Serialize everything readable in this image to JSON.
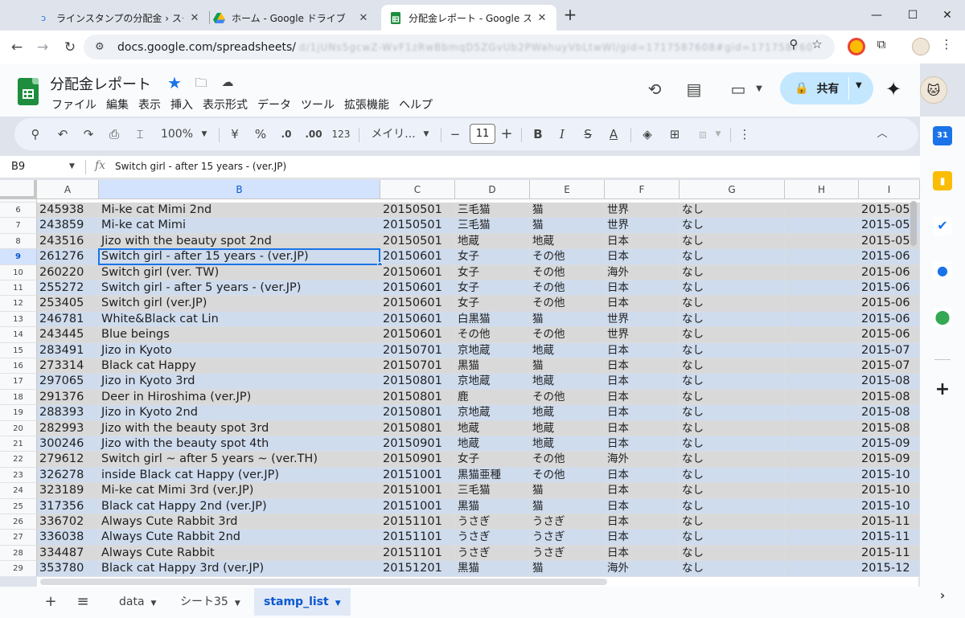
{
  "browser": {
    "tabs": [
      {
        "title": "ラインスタンプの分配金 › スタンプ制",
        "favicon": "spinner-icon",
        "active": false
      },
      {
        "title": "ホーム - Google ドライブ",
        "favicon": "drive-icon",
        "active": false
      },
      {
        "title": "分配金レポート - Google スプレッ",
        "favicon": "sheets-icon",
        "active": true
      }
    ],
    "url": "docs.google.com/spreadsheets/",
    "url_blurred": "d/1jUNs5gcwZ-WvF1zRwBbmqD5ZGvUb2PWahuyVbLtwWl/gid=1717587608#gid=1717587608&fvid=78511"
  },
  "document": {
    "title": "分配金レポート",
    "menu": [
      "ファイル",
      "編集",
      "表示",
      "挿入",
      "表示形式",
      "データ",
      "ツール",
      "拡張機能",
      "ヘルプ"
    ],
    "share_label": "共有"
  },
  "toolbar": {
    "zoom": "100%",
    "currency": "¥",
    "percent": "%",
    "dec_decrease": ".0",
    "dec_increase": ".00",
    "number_format": "123",
    "font": "メイリ...",
    "font_size": "11"
  },
  "formula_bar": {
    "cell_ref": "B9",
    "formula": "Switch girl - after 15 years - (ver.JP)"
  },
  "grid": {
    "columns": [
      "A",
      "B",
      "C",
      "D",
      "E",
      "F",
      "G",
      "H",
      "I"
    ],
    "selected_column": "B",
    "selected_row": "9",
    "rows": [
      {
        "n": "6",
        "a": "245938",
        "b": "Mi-ke cat Mimi 2nd",
        "c": "20150501",
        "d": "三毛猫",
        "e": "猫",
        "f": "世界",
        "g": "なし",
        "h": "",
        "i": "2015-05"
      },
      {
        "n": "7",
        "a": "243859",
        "b": "Mi-ke cat Mimi",
        "c": "20150501",
        "d": "三毛猫",
        "e": "猫",
        "f": "世界",
        "g": "なし",
        "h": "",
        "i": "2015-05"
      },
      {
        "n": "8",
        "a": "243516",
        "b": "Jizo with the beauty spot 2nd",
        "c": "20150501",
        "d": "地蔵",
        "e": "地蔵",
        "f": "日本",
        "g": "なし",
        "h": "",
        "i": "2015-05"
      },
      {
        "n": "9",
        "a": "261276",
        "b": "Switch girl - after 15 years - (ver.JP)",
        "c": "20150601",
        "d": "女子",
        "e": "その他",
        "f": "日本",
        "g": "なし",
        "h": "",
        "i": "2015-06"
      },
      {
        "n": "10",
        "a": "260220",
        "b": "Switch girl (ver. TW)",
        "c": "20150601",
        "d": "女子",
        "e": "その他",
        "f": "海外",
        "g": "なし",
        "h": "",
        "i": "2015-06"
      },
      {
        "n": "11",
        "a": "255272",
        "b": "Switch girl - after 5 years - (ver.JP)",
        "c": "20150601",
        "d": "女子",
        "e": "その他",
        "f": "日本",
        "g": "なし",
        "h": "",
        "i": "2015-06"
      },
      {
        "n": "12",
        "a": "253405",
        "b": "Switch girl (ver.JP)",
        "c": "20150601",
        "d": "女子",
        "e": "その他",
        "f": "日本",
        "g": "なし",
        "h": "",
        "i": "2015-06"
      },
      {
        "n": "13",
        "a": "246781",
        "b": "White&Black cat Lin",
        "c": "20150601",
        "d": "白黒猫",
        "e": "猫",
        "f": "世界",
        "g": "なし",
        "h": "",
        "i": "2015-06"
      },
      {
        "n": "14",
        "a": "243445",
        "b": "Blue beings",
        "c": "20150601",
        "d": "その他",
        "e": "その他",
        "f": "世界",
        "g": "なし",
        "h": "",
        "i": "2015-06"
      },
      {
        "n": "15",
        "a": "283491",
        "b": "Jizo in Kyoto",
        "c": "20150701",
        "d": "京地蔵",
        "e": "地蔵",
        "f": "日本",
        "g": "なし",
        "h": "",
        "i": "2015-07"
      },
      {
        "n": "16",
        "a": "273314",
        "b": "Black cat Happy",
        "c": "20150701",
        "d": "黒猫",
        "e": "猫",
        "f": "日本",
        "g": "なし",
        "h": "",
        "i": "2015-07"
      },
      {
        "n": "17",
        "a": "297065",
        "b": "Jizo in Kyoto 3rd",
        "c": "20150801",
        "d": "京地蔵",
        "e": "地蔵",
        "f": "日本",
        "g": "なし",
        "h": "",
        "i": "2015-08"
      },
      {
        "n": "18",
        "a": "291376",
        "b": "Deer in Hiroshima (ver.JP)",
        "c": "20150801",
        "d": "鹿",
        "e": "その他",
        "f": "日本",
        "g": "なし",
        "h": "",
        "i": "2015-08"
      },
      {
        "n": "19",
        "a": "288393",
        "b": "Jizo in Kyoto 2nd",
        "c": "20150801",
        "d": "京地蔵",
        "e": "地蔵",
        "f": "日本",
        "g": "なし",
        "h": "",
        "i": "2015-08"
      },
      {
        "n": "20",
        "a": "282993",
        "b": "Jizo with the beauty spot  3rd",
        "c": "20150801",
        "d": "地蔵",
        "e": "地蔵",
        "f": "日本",
        "g": "なし",
        "h": "",
        "i": "2015-08"
      },
      {
        "n": "21",
        "a": "300246",
        "b": "Jizo with the beauty spot  4th",
        "c": "20150901",
        "d": "地蔵",
        "e": "地蔵",
        "f": "日本",
        "g": "なし",
        "h": "",
        "i": "2015-09"
      },
      {
        "n": "22",
        "a": "279612",
        "b": "Switch girl ~ after 5 years ~ (ver.TH)",
        "c": "20150901",
        "d": "女子",
        "e": "その他",
        "f": "海外",
        "g": "なし",
        "h": "",
        "i": "2015-09"
      },
      {
        "n": "23",
        "a": "326278",
        "b": "inside Black cat Happy (ver.JP)",
        "c": "20151001",
        "d": "黒猫亜種",
        "e": "その他",
        "f": "日本",
        "g": "なし",
        "h": "",
        "i": "2015-10"
      },
      {
        "n": "24",
        "a": "323189",
        "b": "Mi-ke cat Mimi 3rd (ver.JP)",
        "c": "20151001",
        "d": "三毛猫",
        "e": "猫",
        "f": "日本",
        "g": "なし",
        "h": "",
        "i": "2015-10"
      },
      {
        "n": "25",
        "a": "317356",
        "b": "Black cat Happy 2nd (ver.JP)",
        "c": "20151001",
        "d": "黒猫",
        "e": "猫",
        "f": "日本",
        "g": "なし",
        "h": "",
        "i": "2015-10"
      },
      {
        "n": "26",
        "a": "336702",
        "b": "Always Cute Rabbit 3rd",
        "c": "20151101",
        "d": "うさぎ",
        "e": "うさぎ",
        "f": "日本",
        "g": "なし",
        "h": "",
        "i": "2015-11"
      },
      {
        "n": "27",
        "a": "336038",
        "b": "Always Cute Rabbit 2nd",
        "c": "20151101",
        "d": "うさぎ",
        "e": "うさぎ",
        "f": "日本",
        "g": "なし",
        "h": "",
        "i": "2015-11"
      },
      {
        "n": "28",
        "a": "334487",
        "b": "Always Cute Rabbit",
        "c": "20151101",
        "d": "うさぎ",
        "e": "うさぎ",
        "f": "日本",
        "g": "なし",
        "h": "",
        "i": "2015-11"
      },
      {
        "n": "29",
        "a": "353780",
        "b": "Black cat Happy 3rd (ver.JP)",
        "c": "20151201",
        "d": "黒猫",
        "e": "猫",
        "f": "海外",
        "g": "なし",
        "h": "",
        "i": "2015-12"
      }
    ],
    "row_colors": {
      "even": "#d9d9d9",
      "odd": "#cfdcee"
    }
  },
  "sheets": {
    "tabs": [
      "data",
      "シート35",
      "stamp_list"
    ],
    "active": "stamp_list"
  },
  "colors": {
    "accent": "#1a73e8",
    "share_bg": "#c2e7ff",
    "sheets_green": "#1e8e3e"
  }
}
